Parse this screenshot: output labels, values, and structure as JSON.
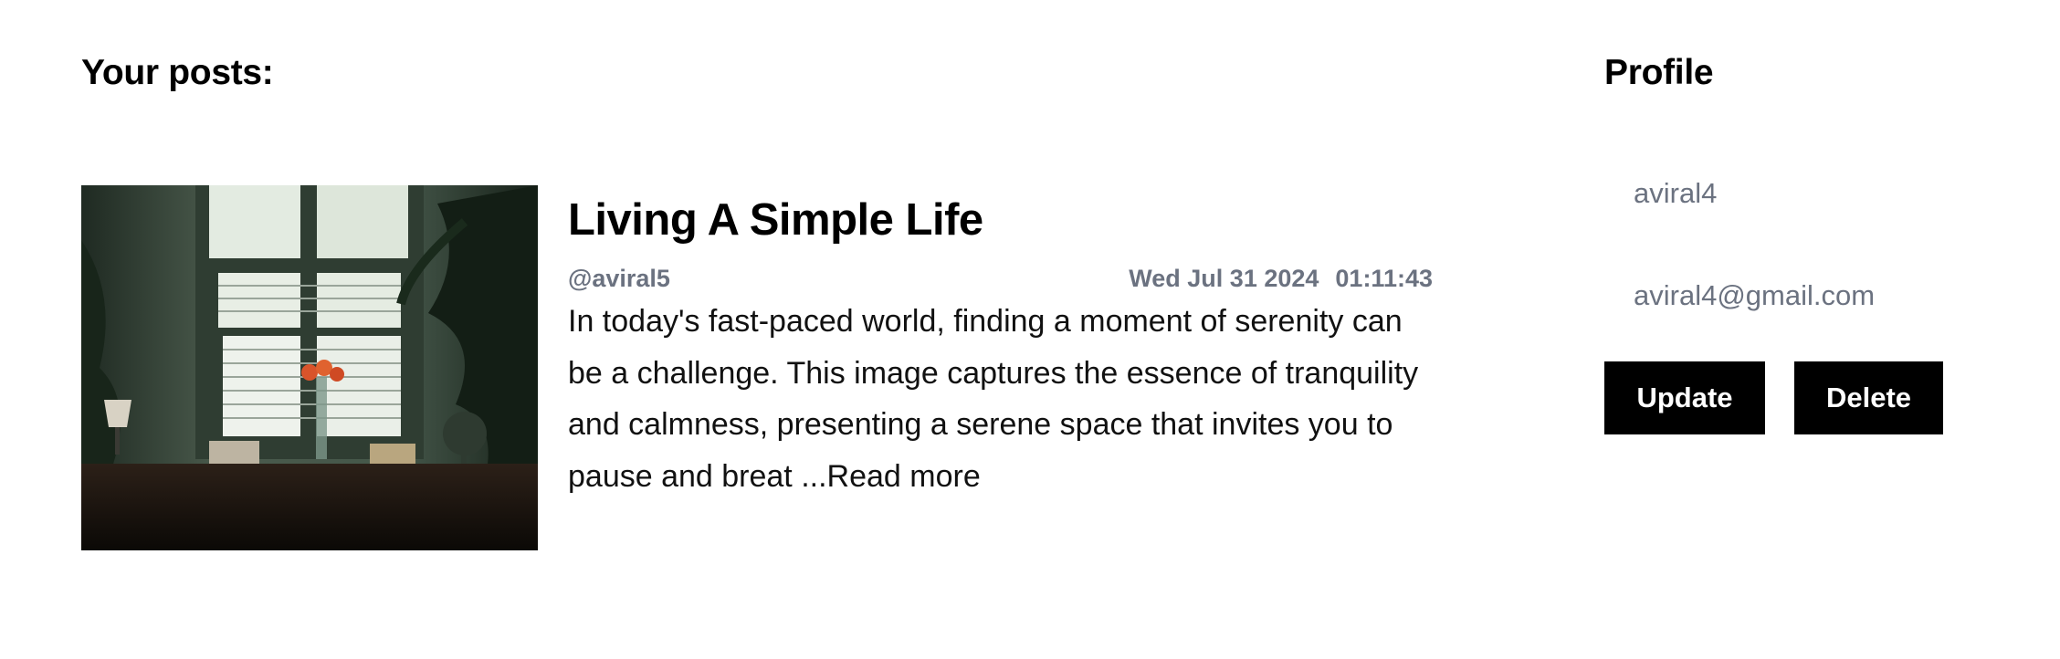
{
  "posts_section": {
    "heading": "Your posts:",
    "posts": [
      {
        "title": "Living A Simple Life",
        "author": "@aviral5",
        "date": "Wed Jul 31 2024",
        "time": "01:11:43",
        "summary": "In today's fast-paced world, finding a moment of serenity can be a challenge. This image captures the essence of tranquility and calmness, presenting a serene space that invites you to pause and breat ...",
        "read_more": "Read more"
      }
    ]
  },
  "profile": {
    "heading": "Profile",
    "username": "aviral4",
    "email": "aviral4@gmail.com",
    "update_label": "Update",
    "delete_label": "Delete"
  },
  "colors": {
    "muted_text": "#6b7280",
    "button_bg": "#000000",
    "button_text": "#ffffff"
  }
}
